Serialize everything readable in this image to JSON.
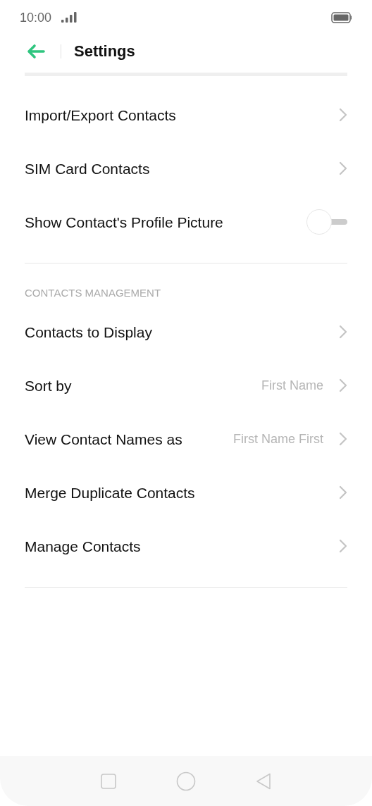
{
  "status_bar": {
    "time": "10:00"
  },
  "header": {
    "title": "Settings"
  },
  "groups": [
    {
      "rows": [
        {
          "kind": "link",
          "label": "Import/Export Contacts"
        },
        {
          "kind": "link",
          "label": "SIM Card Contacts"
        },
        {
          "kind": "toggle",
          "label": "Show Contact's Profile Picture",
          "on": false
        }
      ]
    },
    {
      "heading": "CONTACTS MANAGEMENT",
      "rows": [
        {
          "kind": "link",
          "label": "Contacts to Display"
        },
        {
          "kind": "link",
          "label": "Sort by",
          "value": "First Name"
        },
        {
          "kind": "link",
          "label": "View Contact Names as",
          "value": "First Name First"
        },
        {
          "kind": "link",
          "label": "Merge Duplicate Contacts"
        },
        {
          "kind": "link",
          "label": "Manage Contacts"
        }
      ]
    }
  ]
}
